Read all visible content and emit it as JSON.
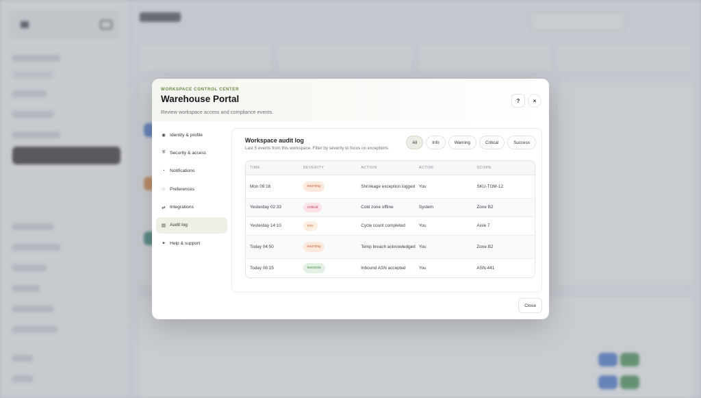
{
  "modal": {
    "eyebrow": "WORKSPACE CONTROL CENTER",
    "title": "Warehouse Portal",
    "subtitle": "Review workspace access and compliance events.",
    "help_label": "?",
    "close_icon": "×",
    "close_button": "Close"
  },
  "sidebar": {
    "items": [
      {
        "label": "Identity & profile",
        "icon": "◉"
      },
      {
        "label": "Security & access",
        "icon": "⛨"
      },
      {
        "label": "Notifications",
        "icon": "◔"
      },
      {
        "label": "Preferences",
        "icon": "○"
      },
      {
        "label": "Integrations",
        "icon": "⇄"
      },
      {
        "label": "Audit log",
        "icon": "▤"
      },
      {
        "label": "Help & support",
        "icon": "✦"
      }
    ],
    "active_index": 5
  },
  "audit": {
    "title": "Workspace audit log",
    "subtitle": "Last 5 events from this workspace. Filter by severity to focus on exceptions.",
    "filters": [
      "All",
      "Info",
      "Warning",
      "Critical",
      "Success"
    ],
    "active_filter": "All",
    "columns": [
      "TIME",
      "SEVERITY",
      "ACTION",
      "ACTOR",
      "SCOPE"
    ],
    "rows": [
      {
        "time": "Mon 09:18",
        "severity": "warning",
        "action": "Shrinkage exception logged",
        "actor": "You",
        "scope": "SKU-TOM-12"
      },
      {
        "time": "Yesterday 02:33",
        "severity": "critical",
        "action": "Cold zone offline",
        "actor": "System",
        "scope": "Zone B2"
      },
      {
        "time": "Yesterday 14:10",
        "severity": "info",
        "action": "Cycle count completed",
        "actor": "You",
        "scope": "Aisle 7"
      },
      {
        "time": "Today 04:50",
        "severity": "warning",
        "action": "Temp breach acknowledged",
        "actor": "You",
        "scope": "Zone B2"
      },
      {
        "time": "Today 06:15",
        "severity": "success",
        "action": "Inbound ASN accepted",
        "actor": "You",
        "scope": "ASN-441"
      }
    ]
  }
}
